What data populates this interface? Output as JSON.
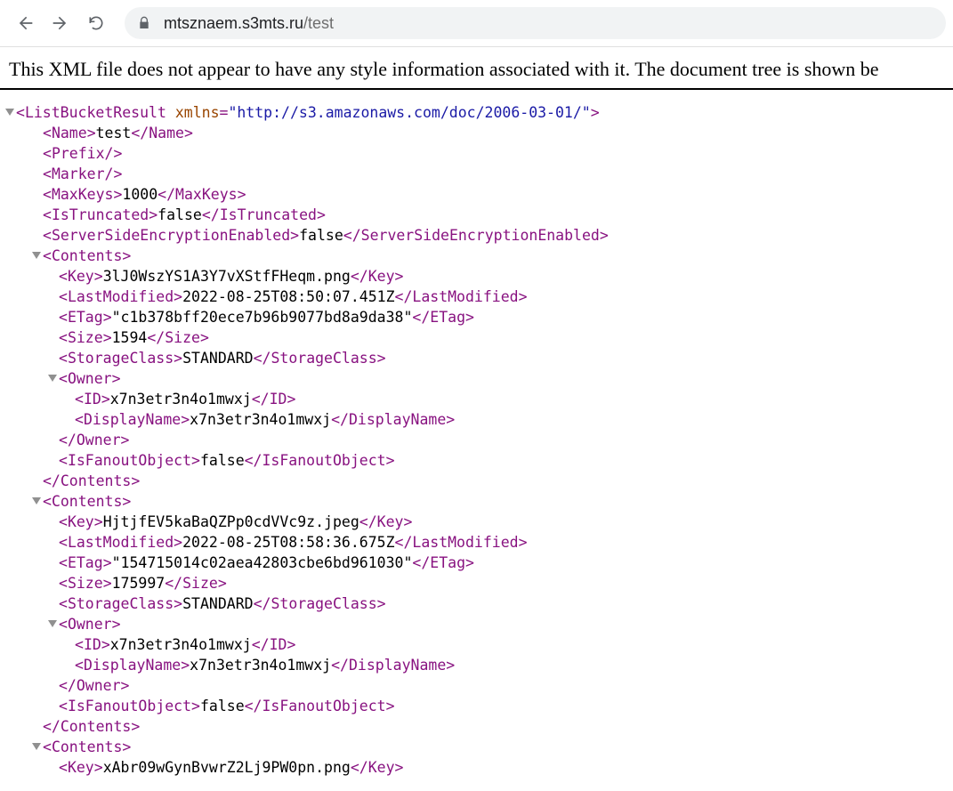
{
  "browser": {
    "url_host": "mtsznaem.s3mts.ru",
    "url_path": "/test"
  },
  "notice": "This XML file does not appear to have any style information associated with it. The document tree is shown be",
  "xml": {
    "root_tag": "ListBucketResult",
    "xmlns_attr": "xmlns",
    "xmlns_val": "\"http://s3.amazonaws.com/doc/2006-03-01/\"",
    "name_tag": "Name",
    "name_val": "test",
    "prefix_tag": "Prefix",
    "marker_tag": "Marker",
    "maxkeys_tag": "MaxKeys",
    "maxkeys_val": "1000",
    "istrunc_tag": "IsTruncated",
    "istrunc_val": "false",
    "sse_tag": "ServerSideEncryptionEnabled",
    "sse_val": "false",
    "contents_tag": "Contents",
    "key_tag": "Key",
    "lastmod_tag": "LastModified",
    "etag_tag": "ETag",
    "size_tag": "Size",
    "storage_tag": "StorageClass",
    "owner_tag": "Owner",
    "id_tag": "ID",
    "dname_tag": "DisplayName",
    "fanout_tag": "IsFanoutObject",
    "c1": {
      "key": "3lJ0WszYS1A3Y7vXStfFHeqm.png",
      "lastmod": "2022-08-25T08:50:07.451Z",
      "etag": "\"c1b378bff20ece7b96b9077bd8a9da38\"",
      "size": "1594",
      "storage": "STANDARD",
      "owner_id": "x7n3etr3n4o1mwxj",
      "owner_dn": "x7n3etr3n4o1mwxj",
      "fanout": "false"
    },
    "c2": {
      "key": "HjtjfEV5kaBaQZPp0cdVVc9z.jpeg",
      "lastmod": "2022-08-25T08:58:36.675Z",
      "etag": "\"154715014c02aea42803cbe6bd961030\"",
      "size": "175997",
      "storage": "STANDARD",
      "owner_id": "x7n3etr3n4o1mwxj",
      "owner_dn": "x7n3etr3n4o1mwxj",
      "fanout": "false"
    },
    "c3": {
      "key": "xAbr09wGynBvwrZ2Lj9PW0pn.png"
    }
  }
}
